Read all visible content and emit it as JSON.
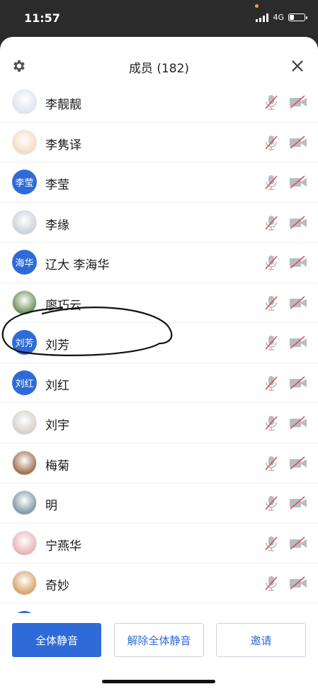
{
  "status_bar": {
    "time": "11:57",
    "network": "4G"
  },
  "header": {
    "title": "成员 (182)",
    "settings_icon": "gear-icon",
    "close_icon": "close-icon"
  },
  "members": [
    {
      "name": "李靓靓",
      "avatar_type": "photo",
      "avatar_color": "#dfe6ee",
      "mic": "mic-off",
      "camera": "camera-off"
    },
    {
      "name": "李隽译",
      "avatar_type": "photo",
      "avatar_color": "#f3dcc2",
      "mic": "mic-off",
      "camera": "camera-off"
    },
    {
      "name": "李莹",
      "avatar_type": "text",
      "avatar_text": "李莹",
      "avatar_color": "#2f6bd8",
      "mic": "mic-off",
      "camera": "camera-off"
    },
    {
      "name": "李缘",
      "avatar_type": "photo",
      "avatar_color": "#c9d3da",
      "mic": "mic-off",
      "camera": "camera-off"
    },
    {
      "name": "辽大 李海华",
      "avatar_type": "text",
      "avatar_text": "海华",
      "avatar_color": "#2f6bd8",
      "mic": "mic-off",
      "camera": "camera-off"
    },
    {
      "name": "廖巧云",
      "avatar_type": "photo",
      "avatar_color": "#6f8f5a",
      "mic": "mic-off",
      "camera": "camera-off"
    },
    {
      "name": "刘芳",
      "avatar_type": "text",
      "avatar_text": "刘芳",
      "avatar_color": "#2f6bd8",
      "mic": "mic-off",
      "camera": "camera-off"
    },
    {
      "name": "刘红",
      "avatar_type": "text",
      "avatar_text": "刘红",
      "avatar_color": "#2f6bd8",
      "mic": "mic-off",
      "camera": "camera-off"
    },
    {
      "name": "刘宇",
      "avatar_type": "photo",
      "avatar_color": "#d6d0c8",
      "mic": "mic-off",
      "camera": "camera-off"
    },
    {
      "name": "梅菊",
      "avatar_type": "photo",
      "avatar_color": "#a0704e",
      "mic": "mic-off",
      "camera": "camera-off"
    },
    {
      "name": "明",
      "avatar_type": "photo",
      "avatar_color": "#7f9aa8",
      "mic": "mic-off",
      "camera": "camera-off"
    },
    {
      "name": "宁燕华",
      "avatar_type": "photo",
      "avatar_color": "#e9b3b8",
      "mic": "mic-off",
      "camera": "camera-off"
    },
    {
      "name": "奇妙",
      "avatar_type": "photo",
      "avatar_color": "#d9a46a",
      "mic": "mic-off",
      "camera": "camera-off"
    },
    {
      "name": "",
      "avatar_type": "text",
      "avatar_text": "",
      "avatar_color": "#2f6bd8",
      "mic": "mic-off",
      "camera": "camera-off"
    }
  ],
  "buttons": {
    "mute_all": "全体静音",
    "unmute_all": "解除全体静音",
    "invite": "邀请"
  },
  "colors": {
    "accent": "#2f6bd8",
    "muted_slash": "#e05050",
    "icon_gray": "#b8bcc4"
  }
}
